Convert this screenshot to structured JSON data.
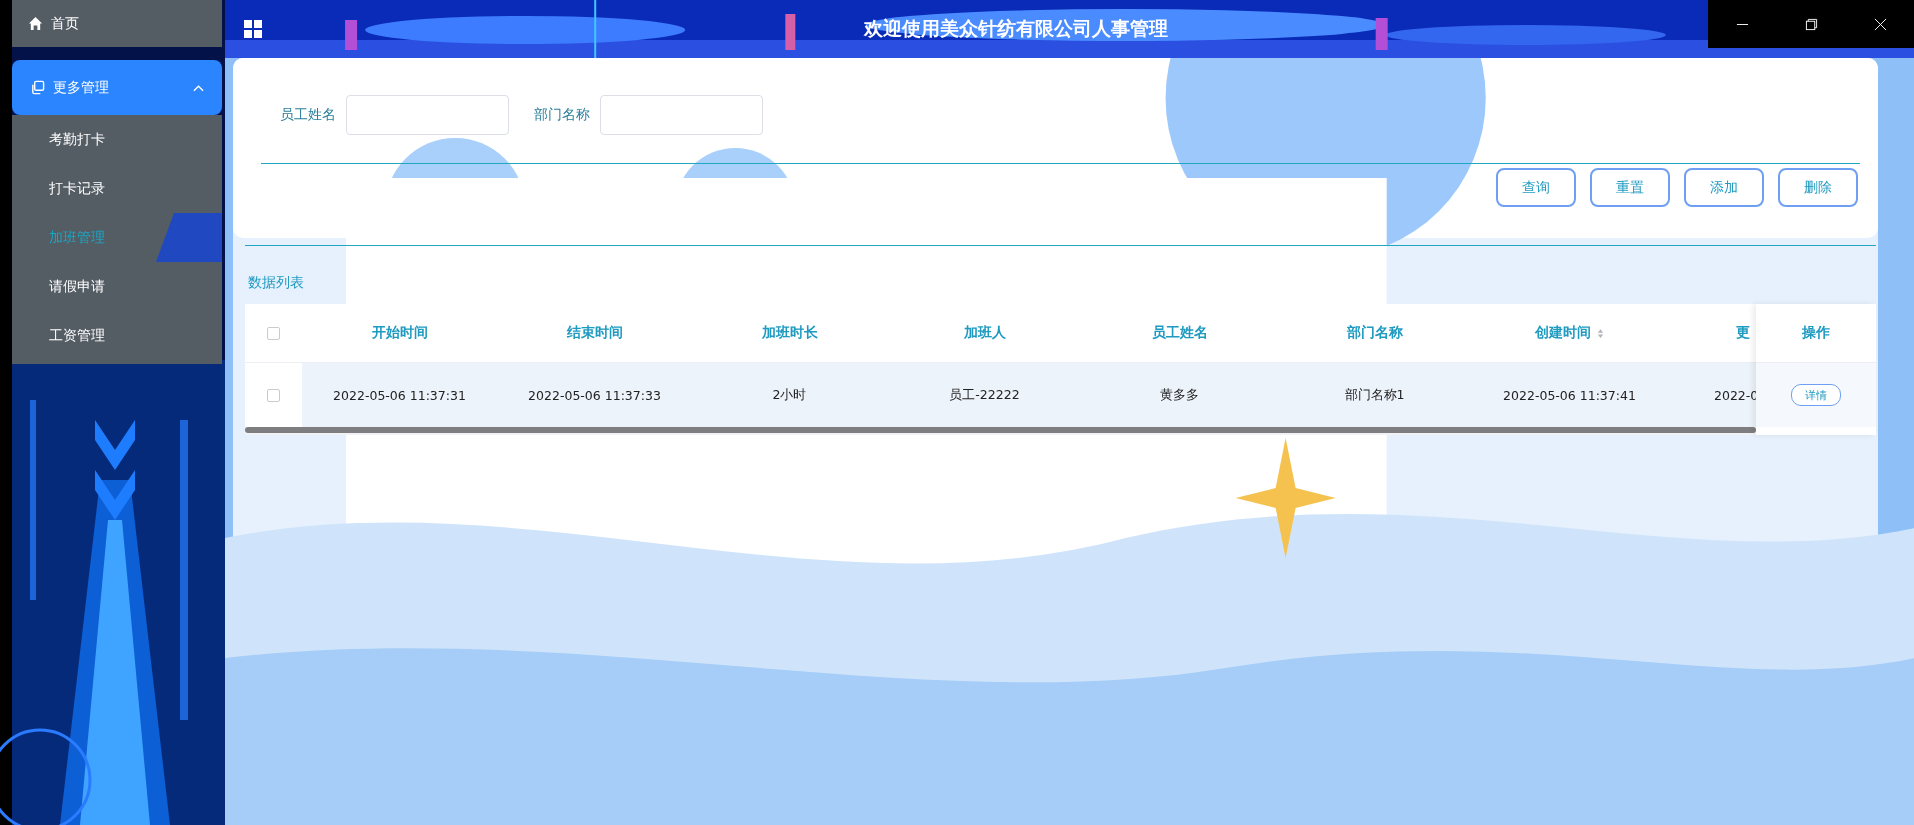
{
  "sidebar": {
    "home": {
      "label": "首页"
    },
    "groups": [
      {
        "label": "更多管理",
        "expanded": true,
        "items": [
          {
            "label": "考勤打卡",
            "selected": false
          },
          {
            "label": "打卡记录",
            "selected": false
          },
          {
            "label": "加班管理",
            "selected": true
          },
          {
            "label": "请假申请",
            "selected": false
          },
          {
            "label": "工资管理",
            "selected": false
          }
        ]
      }
    ]
  },
  "header": {
    "title": "欢迎使用美众针纺有限公司人事管理"
  },
  "search_form": {
    "fields": [
      {
        "label": "员工姓名"
      },
      {
        "label": "部门名称"
      }
    ]
  },
  "buttons": [
    "查询",
    "重置",
    "添加",
    "删除"
  ],
  "table": {
    "title": "数据列表",
    "all_selected": false,
    "columns": [
      {
        "label": "开始时间",
        "sortable": false
      },
      {
        "label": "结束时间",
        "sortable": false
      },
      {
        "label": "加班时长",
        "sortable": false
      },
      {
        "label": "加班人",
        "sortable": false
      },
      {
        "label": "员工姓名",
        "sortable": false
      },
      {
        "label": "部门名称",
        "sortable": false
      },
      {
        "label": "创建时间",
        "sortable": true
      },
      {
        "label": "更"
      }
    ],
    "action_column": "操作",
    "rows": [
      {
        "selected": false,
        "cells": [
          "2022-05-06 11:37:31",
          "2022-05-06 11:37:33",
          "2小时",
          "员工-22222",
          "黄多多",
          "部门名称1",
          "2022-05-06 11:37:41",
          "2022-0"
        ],
        "action": "详情"
      }
    ]
  }
}
